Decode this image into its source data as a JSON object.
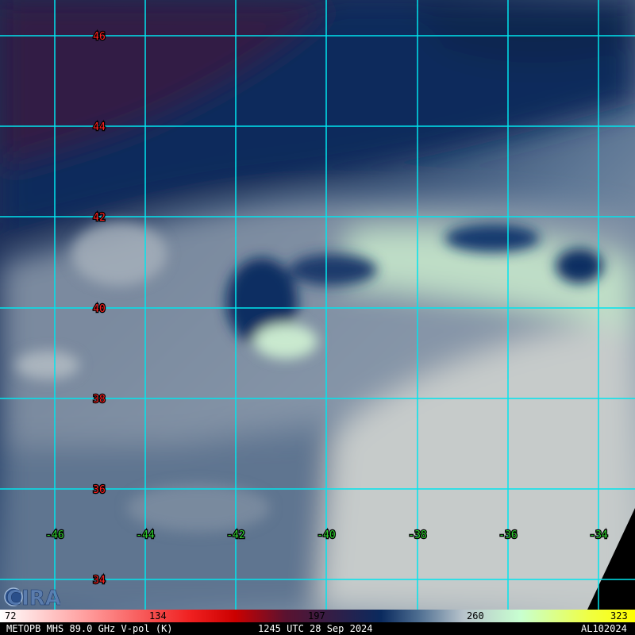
{
  "map": {
    "lat_labels": [
      "46",
      "44",
      "42",
      "40",
      "38",
      "36",
      "34"
    ],
    "lon_labels": [
      "-46",
      "-44",
      "-42",
      "-40",
      "-38",
      "-36",
      "-34"
    ],
    "colors": {
      "grid": "#00e5ee",
      "lat_label": "#ff2020",
      "lon_label": "#30d030",
      "land_dark": "#2a1530",
      "ocean_cold": "#0a2a5e",
      "mid": "#4f6f92",
      "warm": "#c4cac9",
      "cloud_free": "#c8e8cc"
    }
  },
  "legend": {
    "ticks": [
      "72",
      "134",
      "197",
      "260",
      "323"
    ]
  },
  "footer": {
    "sensor": "METOPB MHS 89.0 GHz V-pol (K)",
    "time": "1245 UTC 28 Sep 2024",
    "storm_id": "AL102024"
  },
  "logo": {
    "text": "CIRA"
  }
}
